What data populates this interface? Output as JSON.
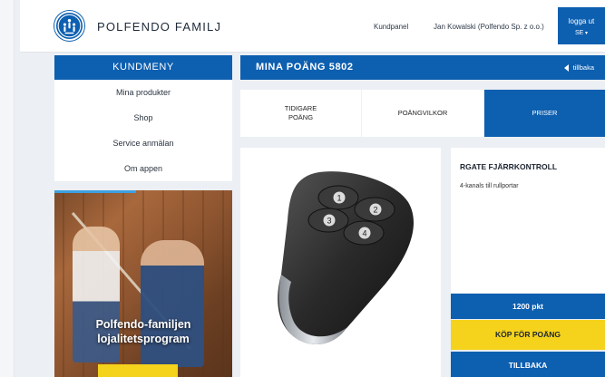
{
  "header": {
    "brand": "POLFENDO FAMILJ",
    "nav_panel": "Kundpanel",
    "user": "Jan Kowalski (Polfendo Sp. z o.o.)",
    "logout": "logga ut",
    "language": "SE"
  },
  "sidebar": {
    "title": "KUNDMENY",
    "items": [
      {
        "label": "Mina produkter"
      },
      {
        "label": "Shop"
      },
      {
        "label": "Service anmälan"
      },
      {
        "label": "Om appen"
      }
    ],
    "promo_text": "Polfendo-familjen lojalitetsprogram"
  },
  "main": {
    "title": "MINA POÄNG 5802",
    "back_link": "tillbaka",
    "tabs": [
      {
        "label": "TIDIGARE\nPOÄNG"
      },
      {
        "label": "POÄNGVILKOR"
      },
      {
        "label": "PRISER",
        "active": true
      }
    ],
    "product": {
      "name": "RGATE FJÄRRKONTROLL",
      "description": "4-kanals till rullportar",
      "price": "1200 pkt",
      "buy_label": "KÖP FÖR POÄNG",
      "back_label": "TILLBAKA",
      "remote_buttons": [
        "1",
        "2",
        "3",
        "4"
      ]
    }
  },
  "colors": {
    "primary": "#0d5fb0",
    "accent_yellow": "#f5d21b",
    "background": "#eceff3"
  },
  "icons": {
    "logo": "polfendo-logo-icon",
    "back": "triangle-left-icon",
    "caret": "caret-down-icon"
  }
}
